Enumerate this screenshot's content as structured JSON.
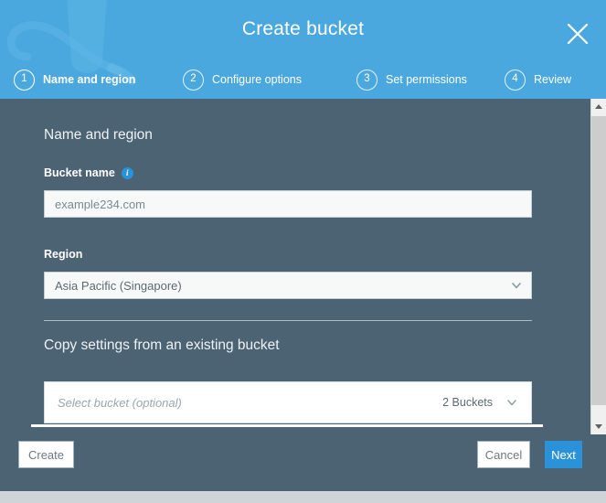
{
  "header": {
    "title": "Create bucket",
    "close_icon": "close-icon",
    "background_color": "#4aa8de",
    "steps": [
      {
        "number": "1",
        "label": "Name and region",
        "active": true
      },
      {
        "number": "2",
        "label": "Configure options",
        "active": false
      },
      {
        "number": "3",
        "label": "Set permissions",
        "active": false
      },
      {
        "number": "4",
        "label": "Review",
        "active": false
      }
    ]
  },
  "body": {
    "background_color": "#4c6374",
    "section_title": "Name and region",
    "bucket_name": {
      "label": "Bucket name",
      "info_icon": "info-icon",
      "value": "example234.com",
      "placeholder": "example234.com"
    },
    "region": {
      "label": "Region",
      "selected": "Asia Pacific (Singapore)",
      "chevron_icon": "chevron-down-icon"
    },
    "copy_settings": {
      "title": "Copy settings from an existing bucket",
      "placeholder": "Select bucket (optional)",
      "count": "2 Buckets",
      "chevron_icon": "chevron-down-icon"
    }
  },
  "scrollbar": {
    "up_icon": "scroll-up-arrow-icon",
    "down_icon": "scroll-down-arrow-icon"
  },
  "footer": {
    "create_label": "Create",
    "cancel_label": "Cancel",
    "next_label": "Next",
    "next_color": "#2a92d8"
  }
}
